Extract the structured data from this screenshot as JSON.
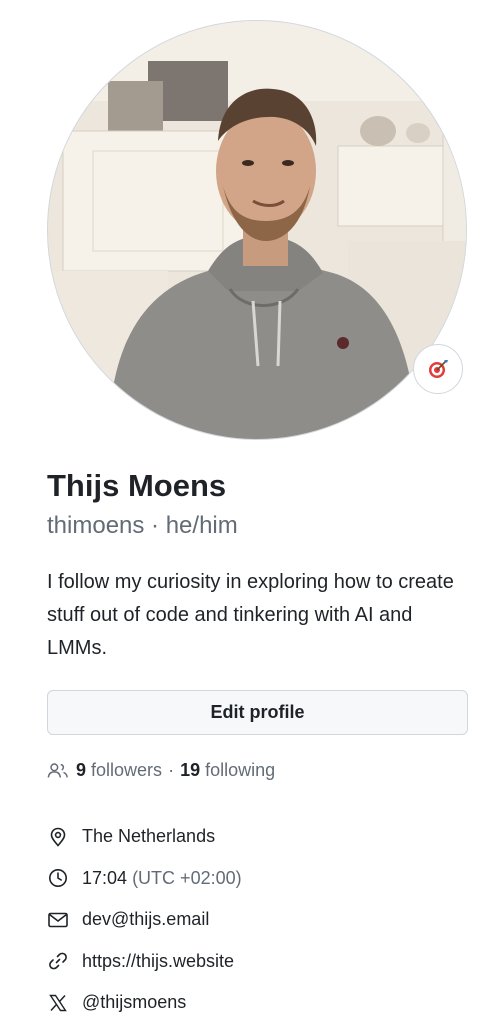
{
  "profile": {
    "name": "Thijs Moens",
    "login_line": "thimoens · he/him",
    "bio": "I follow my curiosity in exploring how to create stuff out of code and tinkering with AI and LMMs.",
    "edit_label": "Edit profile",
    "status_icon": "dart-target-emoji"
  },
  "follow": {
    "followers_count": "9",
    "followers_label": "followers",
    "separator": "·",
    "following_count": "19",
    "following_label": "following"
  },
  "details": {
    "location": "The Netherlands",
    "local_time": "17:04",
    "timezone": "(UTC +02:00)",
    "email": "dev@thijs.email",
    "website": "https://thijs.website",
    "twitter": "@thijsmoens"
  },
  "colors": {
    "text": "#1f2328",
    "muted": "#636c76",
    "border": "#d0d7de",
    "button_bg": "#f6f8fa"
  }
}
